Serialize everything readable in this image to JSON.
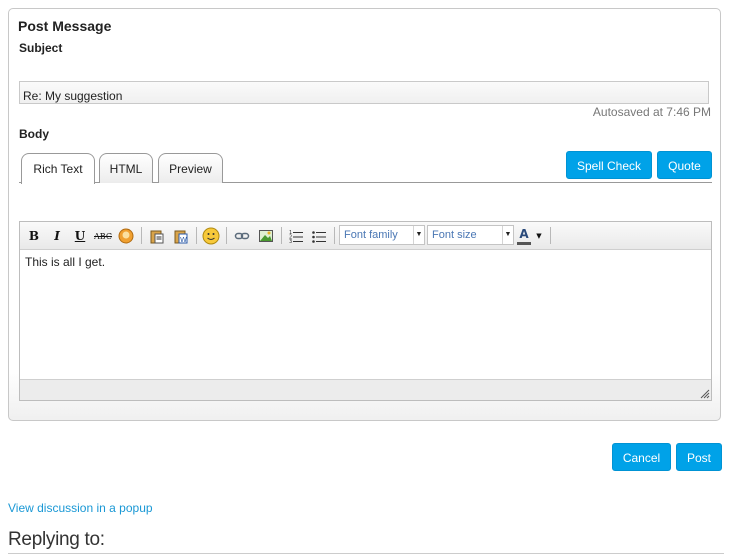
{
  "form": {
    "title": "Post Message",
    "subject_label": "Subject",
    "subject_value": "Re: My suggestion",
    "autosaved": "Autosaved at 7:46 PM",
    "body_label": "Body"
  },
  "tabs": [
    {
      "label": "Rich Text",
      "active": true
    },
    {
      "label": "HTML",
      "active": false
    },
    {
      "label": "Preview",
      "active": false
    }
  ],
  "actions": {
    "spell_check": "Spell Check",
    "quote": "Quote",
    "cancel": "Cancel",
    "post": "Post"
  },
  "toolbar": {
    "bold": "B",
    "italic": "I",
    "underline": "U",
    "strike": "ABC",
    "font_family": "Font family",
    "font_size": "Font size",
    "font_color_glyph": "A",
    "icons": [
      "bold-icon",
      "italic-icon",
      "underline-icon",
      "strikethrough-icon",
      "clear-format-icon",
      "paste-text-icon",
      "paste-word-icon",
      "emoticon-icon",
      "link-icon",
      "image-icon",
      "ordered-list-icon",
      "unordered-list-icon",
      "font-color-icon"
    ]
  },
  "editor": {
    "content": "This is all I get."
  },
  "footer": {
    "popup_link": "View discussion in a popup",
    "replying_to": "Replying to:"
  },
  "colors": {
    "accent": "#00a2e8",
    "link": "#1a98d5"
  }
}
